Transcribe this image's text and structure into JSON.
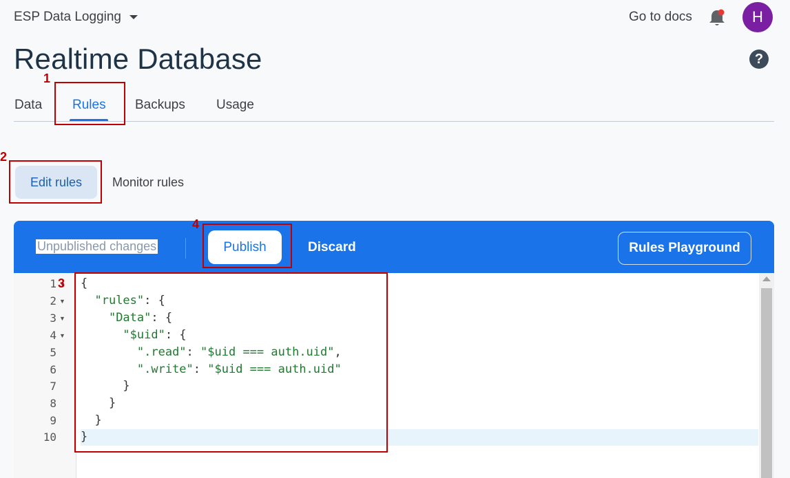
{
  "header": {
    "project_name": "ESP Data Logging",
    "docs_link": "Go to docs",
    "avatar_letter": "H",
    "page_title": "Realtime Database",
    "help_symbol": "?"
  },
  "tabs": [
    {
      "label": "Data"
    },
    {
      "label": "Rules",
      "active": true
    },
    {
      "label": "Backups"
    },
    {
      "label": "Usage"
    }
  ],
  "subtabs": {
    "edit": "Edit rules",
    "monitor": "Monitor rules"
  },
  "toolbar": {
    "status": "Unpublished changes",
    "publish": "Publish",
    "discard": "Discard",
    "playground": "Rules Playground"
  },
  "editor": {
    "line_numbers": [
      "1",
      "2",
      "3",
      "4",
      "5",
      "6",
      "7",
      "8",
      "9",
      "10"
    ],
    "lines": [
      "{",
      "  \"rules\": {",
      "    \"Data\": {",
      "      \"$uid\": {",
      "        \".read\": \"$uid === auth.uid\",",
      "        \".write\": \"$uid === auth.uid\"",
      "      }",
      "    }",
      "  }",
      "}"
    ]
  },
  "annotations": [
    "1",
    "2",
    "3",
    "4"
  ],
  "colors": {
    "accent": "#1a73e8",
    "avatar": "#7b1fa2",
    "annotation": "#c00000",
    "code_string": "#1f7a2e"
  }
}
